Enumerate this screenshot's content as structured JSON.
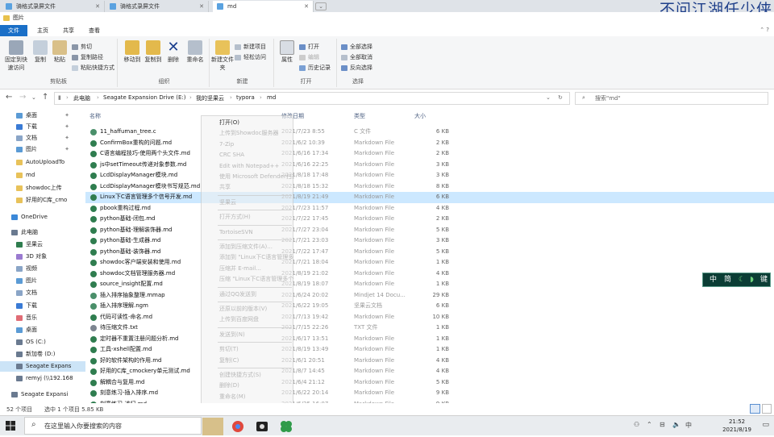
{
  "browser_tabs": [
    {
      "label": "骑格式录屏文件"
    },
    {
      "label": "骑格式录屏文件"
    },
    {
      "label": "md"
    }
  ],
  "watermark": "不问江湖任少侠",
  "window_title": "图片",
  "ribbon_tabs": [
    "文件",
    "主页",
    "共享",
    "查看"
  ],
  "ribbon": {
    "clipboard": {
      "pin": "固定到快速访问",
      "copy": "复制",
      "paste": "粘贴",
      "cut": "剪切",
      "copy_path": "复制路径",
      "paste_shortcut": "粘贴快捷方式",
      "label": "剪贴板"
    },
    "organize": {
      "move_to": "移动到",
      "copy_to": "复制到",
      "delete": "删除",
      "rename": "重命名",
      "label": "组织"
    },
    "new": {
      "new_folder": "新建文件夹",
      "new_item": "新建项目",
      "easy_access": "轻松访问",
      "label": "新建"
    },
    "open": {
      "properties": "属性",
      "open": "打开",
      "edit": "编辑",
      "history": "历史记录",
      "label": "打开"
    },
    "select": {
      "select_all": "全部选择",
      "select_none": "全部取消",
      "invert": "反向选择",
      "label": "选择"
    }
  },
  "address": {
    "crumbs": [
      "此电脑",
      "Seagate Expansion Drive (E:)",
      "我的坚果云",
      "typora",
      "md"
    ],
    "search_placeholder": "搜索\"md\""
  },
  "nav_pane": [
    {
      "label": "桌面",
      "pinned": true
    },
    {
      "label": "下载",
      "pinned": true
    },
    {
      "label": "文档",
      "pinned": true
    },
    {
      "label": "图片",
      "pinned": true
    },
    {
      "label": "AutoUploadTo"
    },
    {
      "label": "md"
    },
    {
      "label": "showdoc上传"
    },
    {
      "label": "好用的C库_cmo"
    },
    {
      "label": "OneDrive"
    },
    {
      "label": "此电脑"
    },
    {
      "label": "坚果云"
    },
    {
      "label": "3D 对象"
    },
    {
      "label": "视频"
    },
    {
      "label": "图片"
    },
    {
      "label": "文档"
    },
    {
      "label": "下载"
    },
    {
      "label": "音乐"
    },
    {
      "label": "桌面"
    },
    {
      "label": "OS (C:)"
    },
    {
      "label": "新加卷 (D:)"
    },
    {
      "label": "Seagate Expans"
    },
    {
      "label": "remyj (\\\\192.168"
    },
    {
      "label": "Seagate Expansi"
    }
  ],
  "columns": {
    "name": "名称",
    "date": "修改日期",
    "type": "类型",
    "size": "大小"
  },
  "files": [
    {
      "name": "11_haffuman_tree.c",
      "date": "2021/7/23 8:55",
      "type": "C 文件",
      "size": "6 KB"
    },
    {
      "name": "ConfirmBox重构的问题.md",
      "date": "2021/6/2 10:39",
      "type": "Markdown File",
      "size": "2 KB"
    },
    {
      "name": "C语言编程技巧-使用两个头文件.md",
      "date": "2021/6/16 17:34",
      "type": "Markdown File",
      "size": "2 KB"
    },
    {
      "name": "js中setTimeout传递对象参数.md",
      "date": "2021/6/16 22:25",
      "type": "Markdown File",
      "size": "3 KB"
    },
    {
      "name": "LcdDisplayManager模块.md",
      "date": "2021/8/18 17:48",
      "type": "Markdown File",
      "size": "3 KB"
    },
    {
      "name": "LcdDisplayManager模块书写规范.md",
      "date": "2021/8/18 15:32",
      "type": "Markdown File",
      "size": "8 KB"
    },
    {
      "name": "Linux下C语言管理多个信号开发.md",
      "date": "2021/8/19 21:49",
      "type": "Markdown File",
      "size": "6 KB"
    },
    {
      "name": "pbook重构过程.md",
      "date": "2021/7/23 11:57",
      "type": "Markdown File",
      "size": "4 KB"
    },
    {
      "name": "python基础-闭包.md",
      "date": "2021/7/22 17:45",
      "type": "Markdown File",
      "size": "2 KB"
    },
    {
      "name": "python基础-理解装饰器.md",
      "date": "2021/7/27 23:04",
      "type": "Markdown File",
      "size": "5 KB"
    },
    {
      "name": "python基础-生成器.md",
      "date": "2021/7/21 23:03",
      "type": "Markdown File",
      "size": "3 KB"
    },
    {
      "name": "python基础-装饰器.md",
      "date": "2021/7/22 17:47",
      "type": "Markdown File",
      "size": "5 KB"
    },
    {
      "name": "showdoc客户端安装和使用.md",
      "date": "2021/7/21 18:04",
      "type": "Markdown File",
      "size": "1 KB"
    },
    {
      "name": "showdoc文档管理服务器.md",
      "date": "2021/8/19 21:02",
      "type": "Markdown File",
      "size": "4 KB"
    },
    {
      "name": "source_insight配置.md",
      "date": "2021/8/19 18:07",
      "type": "Markdown File",
      "size": "1 KB"
    },
    {
      "name": "插入排序抽象整理.mmap",
      "date": "2021/6/24 20:02",
      "type": "Mindjet 14 Docu...",
      "size": "29 KB"
    },
    {
      "name": "插入排序理解.ngm",
      "date": "2021/6/22 19:05",
      "type": "坚果云文档",
      "size": "6 KB"
    },
    {
      "name": "代码可读性-命名.md",
      "date": "2021/7/13 19:42",
      "type": "Markdown File",
      "size": "10 KB"
    },
    {
      "name": "待压缩文件.txt",
      "date": "2021/7/15 22:26",
      "type": "TXT 文件",
      "size": "1 KB"
    },
    {
      "name": "定时器不重置注册问题分析.md",
      "date": "2021/6/17 13:51",
      "type": "Markdown File",
      "size": "1 KB"
    },
    {
      "name": "工具-xshell配置.md",
      "date": "2021/8/19 13:49",
      "type": "Markdown File",
      "size": "1 KB"
    },
    {
      "name": "好的软件架构的作用.md",
      "date": "2021/6/1 20:51",
      "type": "Markdown File",
      "size": "4 KB"
    },
    {
      "name": "好用的C库_cmockery单元测试.md",
      "date": "2021/8/7 14:45",
      "type": "Markdown File",
      "size": "4 KB"
    },
    {
      "name": "解耦合与复用.md",
      "date": "2021/6/4 21:12",
      "type": "Markdown File",
      "size": "5 KB"
    },
    {
      "name": "刻意练习-插入排序.md",
      "date": "2021/6/22 20:14",
      "type": "Markdown File",
      "size": "9 KB"
    },
    {
      "name": "刻意练习-递归.md",
      "date": "2021/6/25 16:07",
      "type": "Markdown File",
      "size": "9 KB"
    }
  ],
  "highlighted_index": 6,
  "context_menu": [
    {
      "label": "打开(O)",
      "strong": true
    },
    {
      "label": "上传到Showdoc服务器"
    },
    {
      "label": "7-Zip"
    },
    {
      "label": "CRC SHA"
    },
    {
      "label": "Edit with Notepad++"
    },
    {
      "label": "使用 Microsoft Defender扫描..."
    },
    {
      "label": "共享"
    },
    {
      "sep": true
    },
    {
      "label": "坚果云"
    },
    {
      "sep": true
    },
    {
      "label": "打开方式(H)"
    },
    {
      "sep": true
    },
    {
      "label": "TortoiseSVN"
    },
    {
      "sep": true
    },
    {
      "label": "添加到压缩文件(A)..."
    },
    {
      "label": "添加到 \"Linux下C语言管理多个信号开发.rar\"(T)"
    },
    {
      "label": "压缩并 E-mail..."
    },
    {
      "label": "压缩 \"Linux下C语言管理多个信号开发.rar\" 并 E-mail"
    },
    {
      "sep": true
    },
    {
      "label": "通过QQ发送到"
    },
    {
      "sep": true
    },
    {
      "label": "还原以前的版本(V)"
    },
    {
      "label": "上传到百度网盘"
    },
    {
      "sep": true
    },
    {
      "label": "发送到(N)"
    },
    {
      "sep": true
    },
    {
      "label": "剪切(T)"
    },
    {
      "label": "复制(C)"
    },
    {
      "sep": true
    },
    {
      "label": "创建快捷方式(S)"
    },
    {
      "label": "删除(D)"
    },
    {
      "label": "重命名(M)"
    },
    {
      "sep": true
    },
    {
      "label": "属性(R)"
    }
  ],
  "ime": {
    "k1": "中",
    "k2": "简",
    "k3": "键"
  },
  "status": {
    "count": "52 个项目",
    "selected": "选中 1 个项目  5.85 KB"
  },
  "taskbar": {
    "search_placeholder": "在这里输入你要搜索的内容",
    "time": "21:52",
    "date": "2021/8/19"
  }
}
